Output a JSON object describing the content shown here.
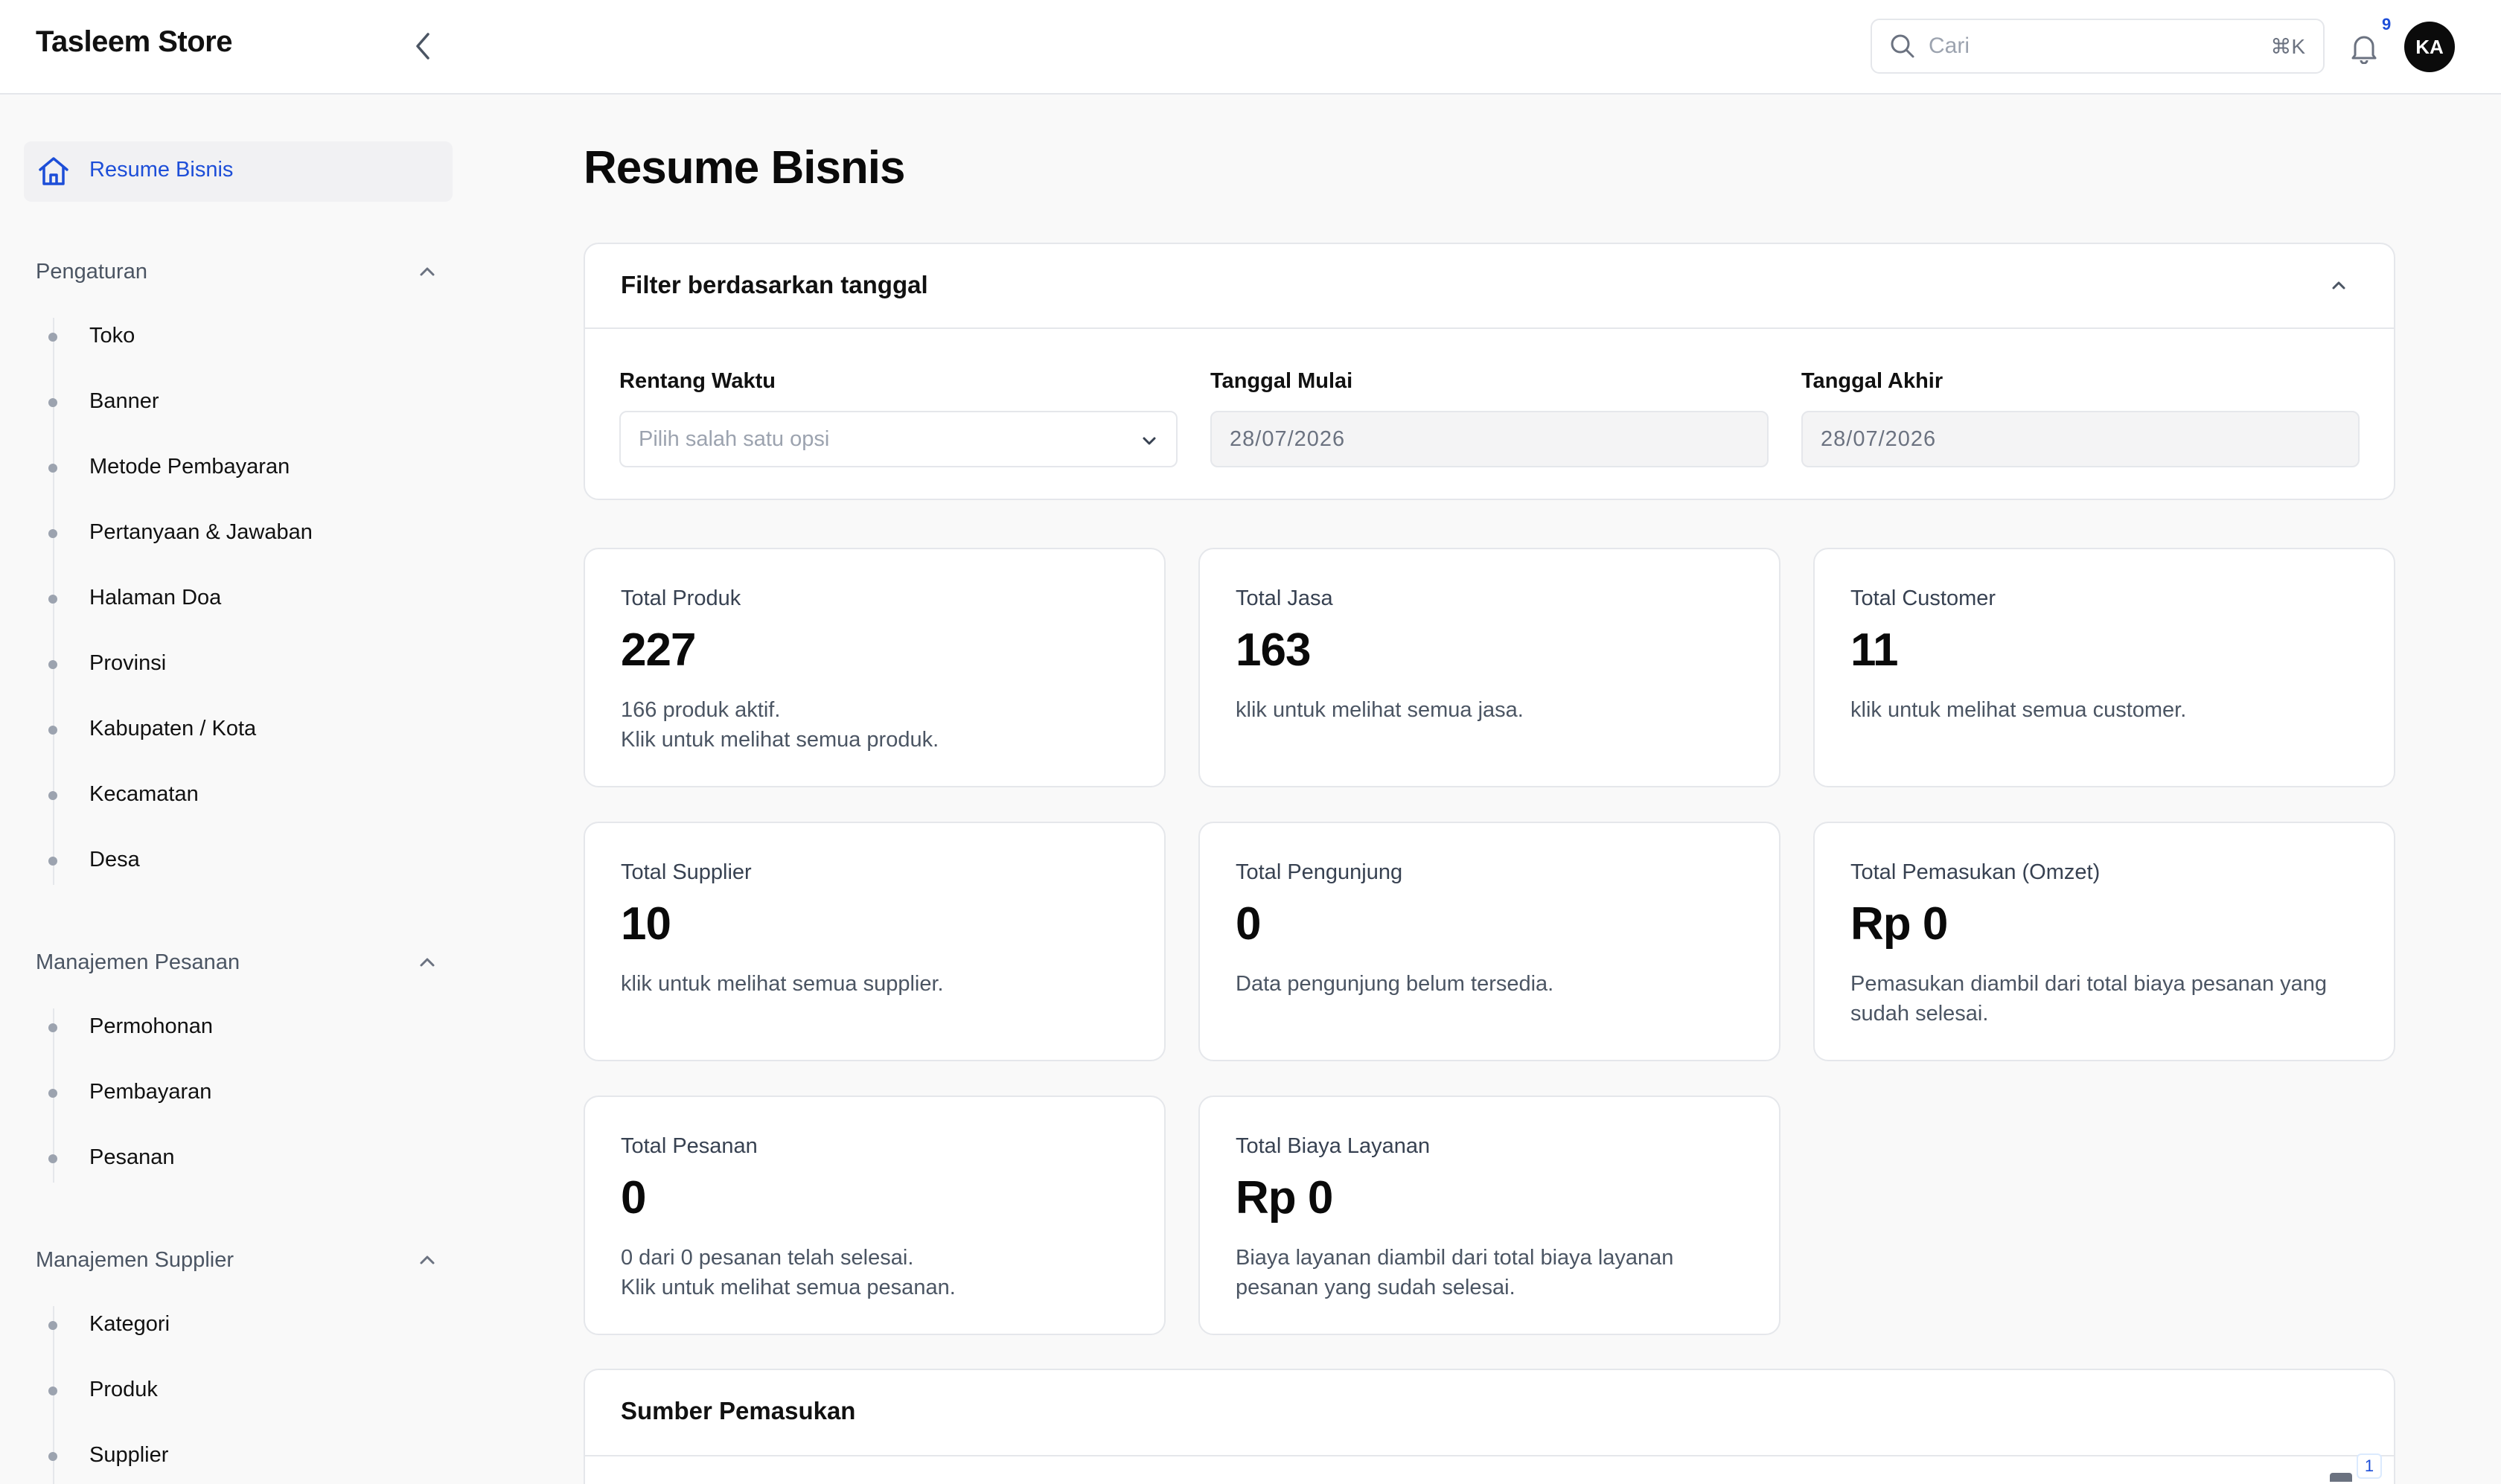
{
  "app": {
    "title": "Tasleem Store"
  },
  "header": {
    "search_placeholder": "Cari",
    "search_shortcut": "⌘K",
    "notification_count": "9",
    "avatar_initials": "KA"
  },
  "sidebar": {
    "active_item": "Resume Bisnis",
    "sections": [
      {
        "title": "Pengaturan",
        "items": [
          "Toko",
          "Banner",
          "Metode Pembayaran",
          "Pertanyaan & Jawaban",
          "Halaman Doa",
          "Provinsi",
          "Kabupaten / Kota",
          "Kecamatan",
          "Desa"
        ]
      },
      {
        "title": "Manajemen Pesanan",
        "items": [
          "Permohonan",
          "Pembayaran",
          "Pesanan"
        ]
      },
      {
        "title": "Manajemen Supplier",
        "items": [
          "Kategori",
          "Produk",
          "Supplier"
        ]
      }
    ]
  },
  "main": {
    "page_title": "Resume Bisnis",
    "filter": {
      "title": "Filter berdasarkan tanggal",
      "range_label": "Rentang Waktu",
      "range_placeholder": "Pilih salah satu opsi",
      "start_label": "Tanggal Mulai",
      "start_value": "28/07/2026",
      "end_label": "Tanggal Akhir",
      "end_value": "28/07/2026"
    },
    "stats": [
      {
        "label": "Total Produk",
        "value": "227",
        "desc1": "166 produk aktif.",
        "desc2": "Klik untuk melihat semua produk."
      },
      {
        "label": "Total Jasa",
        "value": "163",
        "desc1": "klik untuk melihat semua jasa.",
        "desc2": ""
      },
      {
        "label": "Total Customer",
        "value": "11",
        "desc1": "klik untuk melihat semua customer.",
        "desc2": ""
      },
      {
        "label": "Total Supplier",
        "value": "10",
        "desc1": "klik untuk melihat semua supplier.",
        "desc2": ""
      },
      {
        "label": "Total Pengunjung",
        "value": "0",
        "desc1": "Data pengunjung belum tersedia.",
        "desc2": ""
      },
      {
        "label": "Total Pemasukan (Omzet)",
        "value": "Rp 0",
        "desc1": "Pemasukan diambil dari total biaya pesanan yang",
        "desc2": "sudah selesai."
      },
      {
        "label": "Total Pesanan",
        "value": "0",
        "desc1": "0 dari 0 pesanan telah selesai.",
        "desc2": "Klik untuk melihat semua pesanan."
      },
      {
        "label": "Total Biaya Layanan",
        "value": "Rp 0",
        "desc1": "Biaya layanan diambil dari total biaya layanan",
        "desc2": "pesanan yang sudah selesai."
      }
    ],
    "income_title": "Sumber Pemasukan",
    "income_badge": "1"
  }
}
